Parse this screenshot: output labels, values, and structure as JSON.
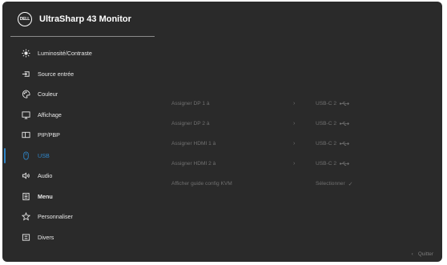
{
  "header": {
    "logo_text": "DELL",
    "title": "UltraSharp 43 Monitor"
  },
  "sidebar": {
    "items": [
      {
        "label": "Luminosité/Contraste",
        "icon": "sun-icon"
      },
      {
        "label": "Source entrée",
        "icon": "input-source-icon"
      },
      {
        "label": "Couleur",
        "icon": "palette-icon"
      },
      {
        "label": "Affichage",
        "icon": "display-icon"
      },
      {
        "label": "PIP/PBP",
        "icon": "pip-icon"
      },
      {
        "label": "USB",
        "icon": "mouse-icon"
      },
      {
        "label": "Audio",
        "icon": "speaker-icon"
      },
      {
        "label": "Menu",
        "icon": "menu-icon"
      },
      {
        "label": "Personnaliser",
        "icon": "star-icon"
      },
      {
        "label": "Divers",
        "icon": "misc-icon"
      }
    ],
    "active": "USB"
  },
  "usb_settings": {
    "rows": [
      {
        "label": "Assigner DP 1 à",
        "value": "USB-C 2"
      },
      {
        "label": "Assigner DP 2 à",
        "value": "USB-C 2"
      },
      {
        "label": "Assigner HDMI 1 à",
        "value": "USB-C 2"
      },
      {
        "label": "Assigner HDMI 2 à",
        "value": "USB-C 2"
      }
    ],
    "kvm_guide": {
      "label": "Afficher guide config KVM",
      "value": "Sélectionner"
    },
    "chevron": "›",
    "check": "✓"
  },
  "footer": {
    "quit_label": "Quitter",
    "quit_arrow": "‹"
  },
  "colors": {
    "background": "#2a2a2a",
    "accent": "#2f86c9",
    "text": "#e8e8e8",
    "dim_text": "#707070"
  }
}
